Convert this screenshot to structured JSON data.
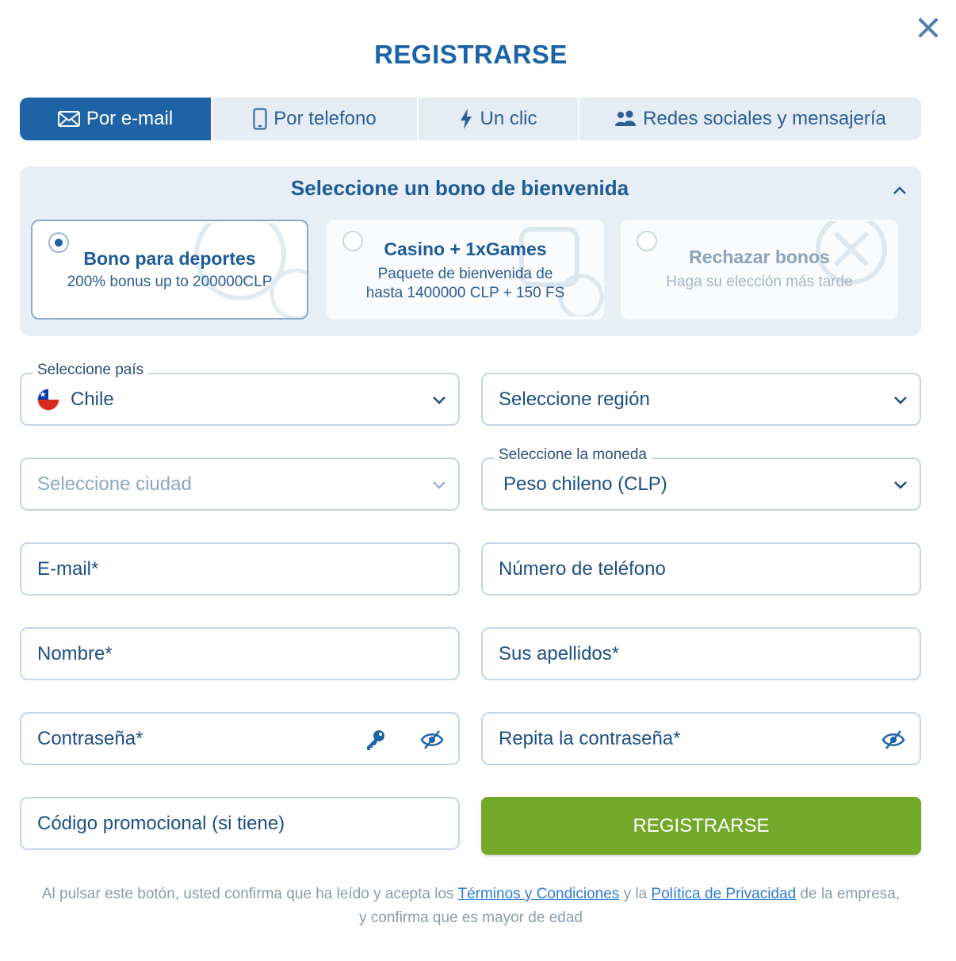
{
  "header": {
    "title": "REGISTRARSE",
    "close_icon": "close-icon"
  },
  "tabs": [
    {
      "label": "Por e-mail",
      "icon": "envelope-icon",
      "active": true
    },
    {
      "label": "Por telefono",
      "icon": "mobile-phone-icon",
      "active": false
    },
    {
      "label": "Un clic",
      "icon": "lightning-icon",
      "active": false
    },
    {
      "label": "Redes sociales y mensajería",
      "icon": "users-icon",
      "active": false
    }
  ],
  "bonus": {
    "title": "Seleccione un bono de bienvenida",
    "options": [
      {
        "title": "Bono para deportes",
        "subtitle": "200% bonus up to 200000CLP",
        "selected": true
      },
      {
        "title": "Casino + 1xGames",
        "subtitle_line1": "Paquete de bienvenida de",
        "subtitle_line2": "hasta 1400000 CLP + 150 FS",
        "selected": false
      },
      {
        "title": "Rechazar bonos",
        "subtitle": "Haga su elección más tarde",
        "selected": false
      }
    ]
  },
  "form": {
    "country": {
      "label": "Seleccione país",
      "value": "Chile"
    },
    "region": {
      "placeholder": "Seleccione región"
    },
    "city": {
      "placeholder": "Seleccione ciudad"
    },
    "currency": {
      "label": "Seleccione la moneda",
      "value": "Peso chileno (CLP)"
    },
    "email": {
      "placeholder": "E-mail*"
    },
    "phone": {
      "placeholder": "Número de teléfono"
    },
    "first_name": {
      "placeholder": "Nombre*"
    },
    "last_name": {
      "placeholder": "Sus apellidos*"
    },
    "password": {
      "placeholder": "Contraseña*"
    },
    "repeat_password": {
      "placeholder": "Repita la contraseña*"
    },
    "promo": {
      "placeholder": "Código promocional (si tiene)"
    },
    "submit_label": "REGISTRARSE"
  },
  "legal": {
    "part1": "Al pulsar este botón, usted confirma que ha leído y acepta los",
    "terms_link": "Términos y Condiciones",
    "part2": "y la",
    "privacy_link": "Política de Privacidad",
    "part3": "de la empresa,",
    "line2": "y confirma que es mayor de edad"
  },
  "colors": {
    "primary": "#1d63a6",
    "submit": "#74a82a",
    "tab_bg": "#e5ecf4",
    "panel_bg": "#e7eef5",
    "border": "#c6d5e5",
    "link": "#2e7bd0"
  }
}
